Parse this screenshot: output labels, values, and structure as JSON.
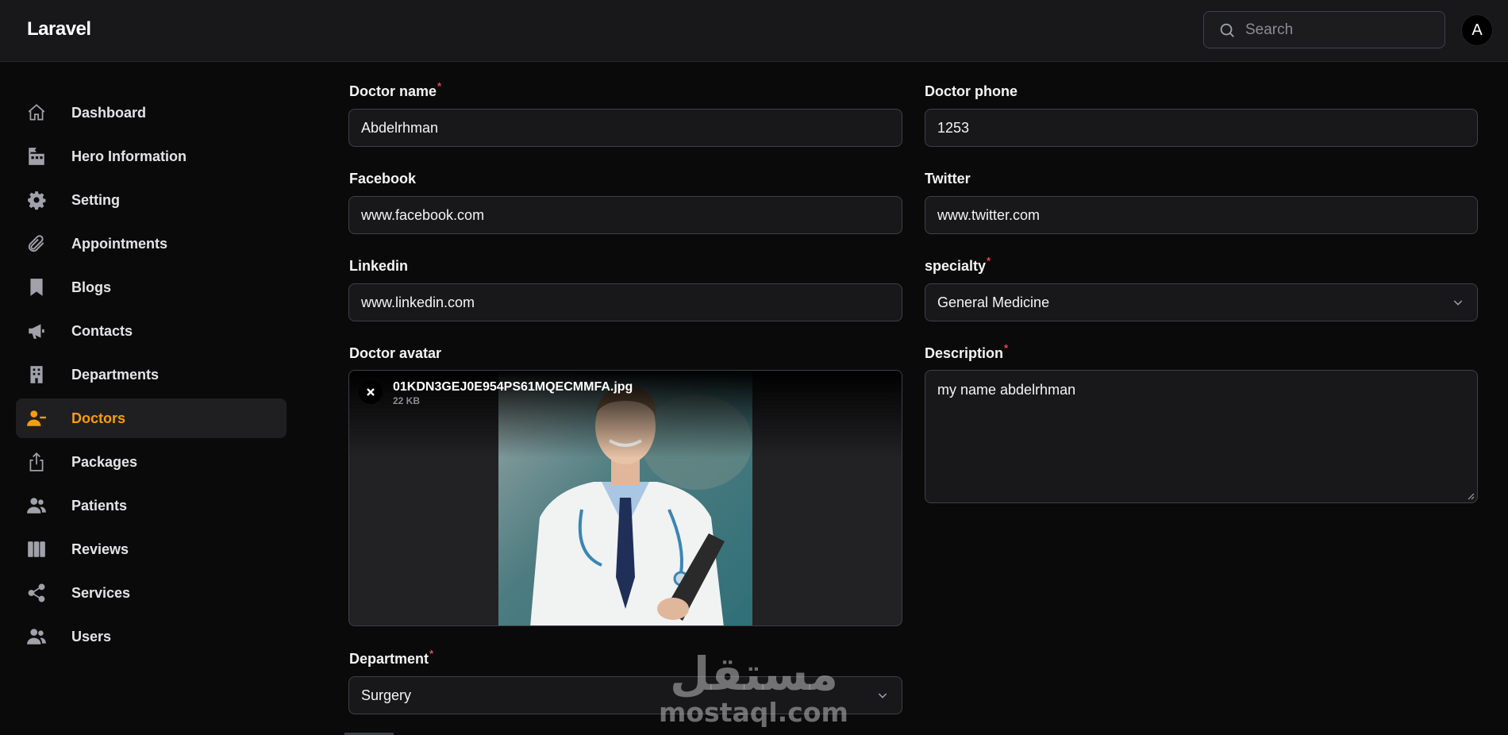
{
  "app": {
    "brand": "Laravel"
  },
  "header": {
    "search_placeholder": "Search",
    "avatar_initial": "A"
  },
  "sidebar": {
    "items": [
      {
        "label": "Dashboard",
        "icon": "home-icon"
      },
      {
        "label": "Hero Information",
        "icon": "building-flag-icon"
      },
      {
        "label": "Setting",
        "icon": "gear-icon"
      },
      {
        "label": "Appointments",
        "icon": "paperclip-icon"
      },
      {
        "label": "Blogs",
        "icon": "bookmark-icon"
      },
      {
        "label": "Contacts",
        "icon": "megaphone-icon"
      },
      {
        "label": "Departments",
        "icon": "office-building-icon"
      },
      {
        "label": "Doctors",
        "icon": "user-minus-icon",
        "active": true
      },
      {
        "label": "Packages",
        "icon": "share-upload-icon"
      },
      {
        "label": "Patients",
        "icon": "users-icon"
      },
      {
        "label": "Reviews",
        "icon": "columns-icon"
      },
      {
        "label": "Services",
        "icon": "share-icon"
      },
      {
        "label": "Users",
        "icon": "users-icon"
      }
    ]
  },
  "form": {
    "doctor_name": {
      "label": "Doctor name",
      "required": "*",
      "value": "Abdelrhman"
    },
    "doctor_phone": {
      "label": "Doctor phone",
      "value": "1253"
    },
    "facebook": {
      "label": "Facebook",
      "value": "www.facebook.com"
    },
    "twitter": {
      "label": "Twitter",
      "value": "www.twitter.com"
    },
    "linkedin": {
      "label": "Linkedin",
      "value": "www.linkedin.com"
    },
    "specialty": {
      "label": "specialty",
      "required": "*",
      "value": "General Medicine"
    },
    "avatar": {
      "label": "Doctor avatar",
      "file_name": "01KDN3GEJ0E954PS61MQECMMFA.jpg",
      "file_size": "22 KB"
    },
    "description": {
      "label": "Description",
      "required": "*",
      "value": "my name abdelrhman"
    },
    "department": {
      "label": "Department",
      "required": "*",
      "value": "Surgery"
    }
  },
  "watermark": {
    "arabic": "مستقل",
    "latin": "mostaql.com"
  },
  "colors": {
    "accent": "#f59e0b",
    "required": "#ef4444",
    "background": "#0a0a0b",
    "surface": "#18181b"
  }
}
